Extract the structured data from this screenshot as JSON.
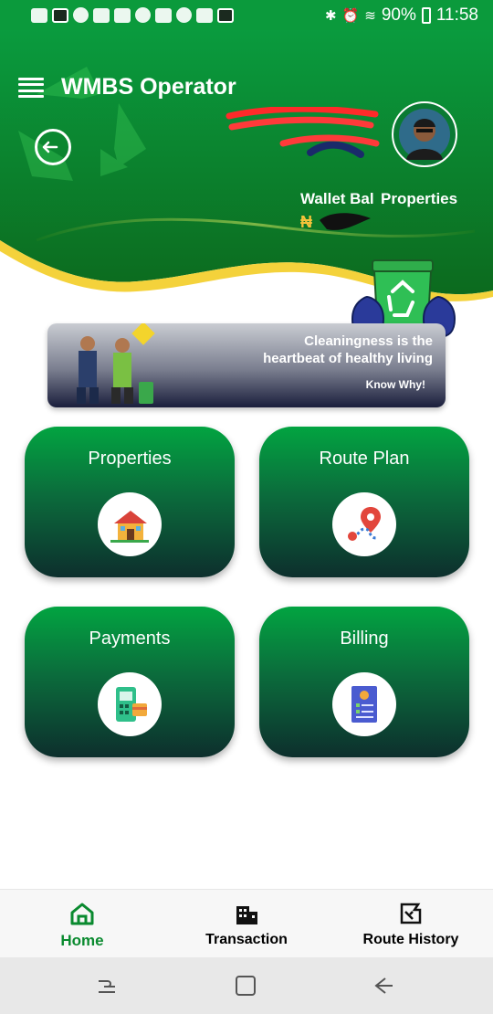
{
  "status_bar": {
    "battery": "90%",
    "time": "11:58",
    "colors": {
      "background": "#0b9a3c"
    }
  },
  "header": {
    "menu_icon": "hamburger-menu-icon",
    "title": "WMBS Operator",
    "logout_icon": "logout-icon",
    "wallet_label": "Wallet Bal",
    "properties_label": "Properties",
    "currency_symbol": "₦",
    "colors": {
      "gradient_top": "#0a9b3e",
      "gradient_bottom": "#0c6a1e",
      "wave_accent": "#f4d23b"
    }
  },
  "banner": {
    "line1": "Cleaningness is the",
    "line2": "heartbeat of healthy living",
    "link": "Know Why!"
  },
  "tiles": [
    {
      "label": "Properties",
      "icon": "house-icon"
    },
    {
      "label": "Route Plan",
      "icon": "route-pin-icon"
    },
    {
      "label": "Payments",
      "icon": "pos-terminal-icon"
    },
    {
      "label": "Billing",
      "icon": "invoice-icon"
    }
  ],
  "bottom_nav": {
    "items": [
      {
        "label": "Home",
        "icon": "home-icon",
        "active": true
      },
      {
        "label": "Transaction",
        "icon": "building-icon",
        "active": false
      },
      {
        "label": "Route History",
        "icon": "route-history-icon",
        "active": false
      }
    ],
    "colors": {
      "active": "#0a8a2f"
    }
  }
}
